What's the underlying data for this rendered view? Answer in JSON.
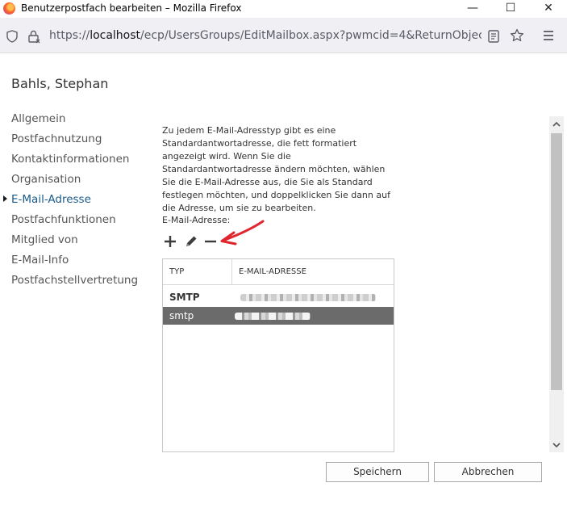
{
  "window": {
    "title": "Benutzerpostfach bearbeiten – Mozilla Firefox",
    "controls": {
      "minimize": "—",
      "maximize": "☐",
      "close": "✕"
    }
  },
  "urlbar": {
    "protocol": "https://",
    "host": "localhost",
    "path": "/ecp/UsersGroups/EditMailbox.aspx?pwmcid=4&ReturnObjectType=1&i",
    "icons": [
      "shield-icon",
      "lock-icon",
      "reader-view-icon",
      "bookmark-star-icon",
      "hamburger-menu-icon"
    ]
  },
  "page": {
    "title": "Bahls, Stephan"
  },
  "nav": {
    "items": [
      {
        "label": "Allgemein",
        "active": false
      },
      {
        "label": "Postfachnutzung",
        "active": false
      },
      {
        "label": "Kontaktinformationen",
        "active": false
      },
      {
        "label": "Organisation",
        "active": false
      },
      {
        "label": "E-Mail-Adresse",
        "active": true
      },
      {
        "label": "Postfachfunktionen",
        "active": false
      },
      {
        "label": "Mitglied von",
        "active": false
      },
      {
        "label": "E-Mail-Info",
        "active": false
      },
      {
        "label": "Postfachstellvertretung",
        "active": false
      }
    ]
  },
  "content": {
    "description": "Zu jedem E-Mail-Adresstyp gibt es eine Standardantwortadresse, die fett formatiert angezeigt wird. Wenn Sie die Standardantwortadresse ändern möchten, wählen Sie die E-Mail-Adresse aus, die Sie als Standard festlegen möchten, und doppelklicken Sie dann auf die Adresse, um sie zu bearbeiten.",
    "field_label": "E-Mail-Adresse:",
    "toolbar_icons": [
      "plus-icon",
      "pencil-icon",
      "minus-icon"
    ],
    "annotation_color": "#e0262f",
    "table": {
      "columns": [
        "TYP",
        "E-MAIL-ADRESSE"
      ],
      "rows": [
        {
          "type": "SMTP",
          "email": "",
          "bold": true,
          "selected": false
        },
        {
          "type": "smtp",
          "email": "",
          "bold": false,
          "selected": true
        }
      ]
    }
  },
  "footer": {
    "save_label": "Speichern",
    "cancel_label": "Abbrechen"
  },
  "colors": {
    "active_nav": "#1a5b8a",
    "selected_row": "#6b6b6b"
  }
}
